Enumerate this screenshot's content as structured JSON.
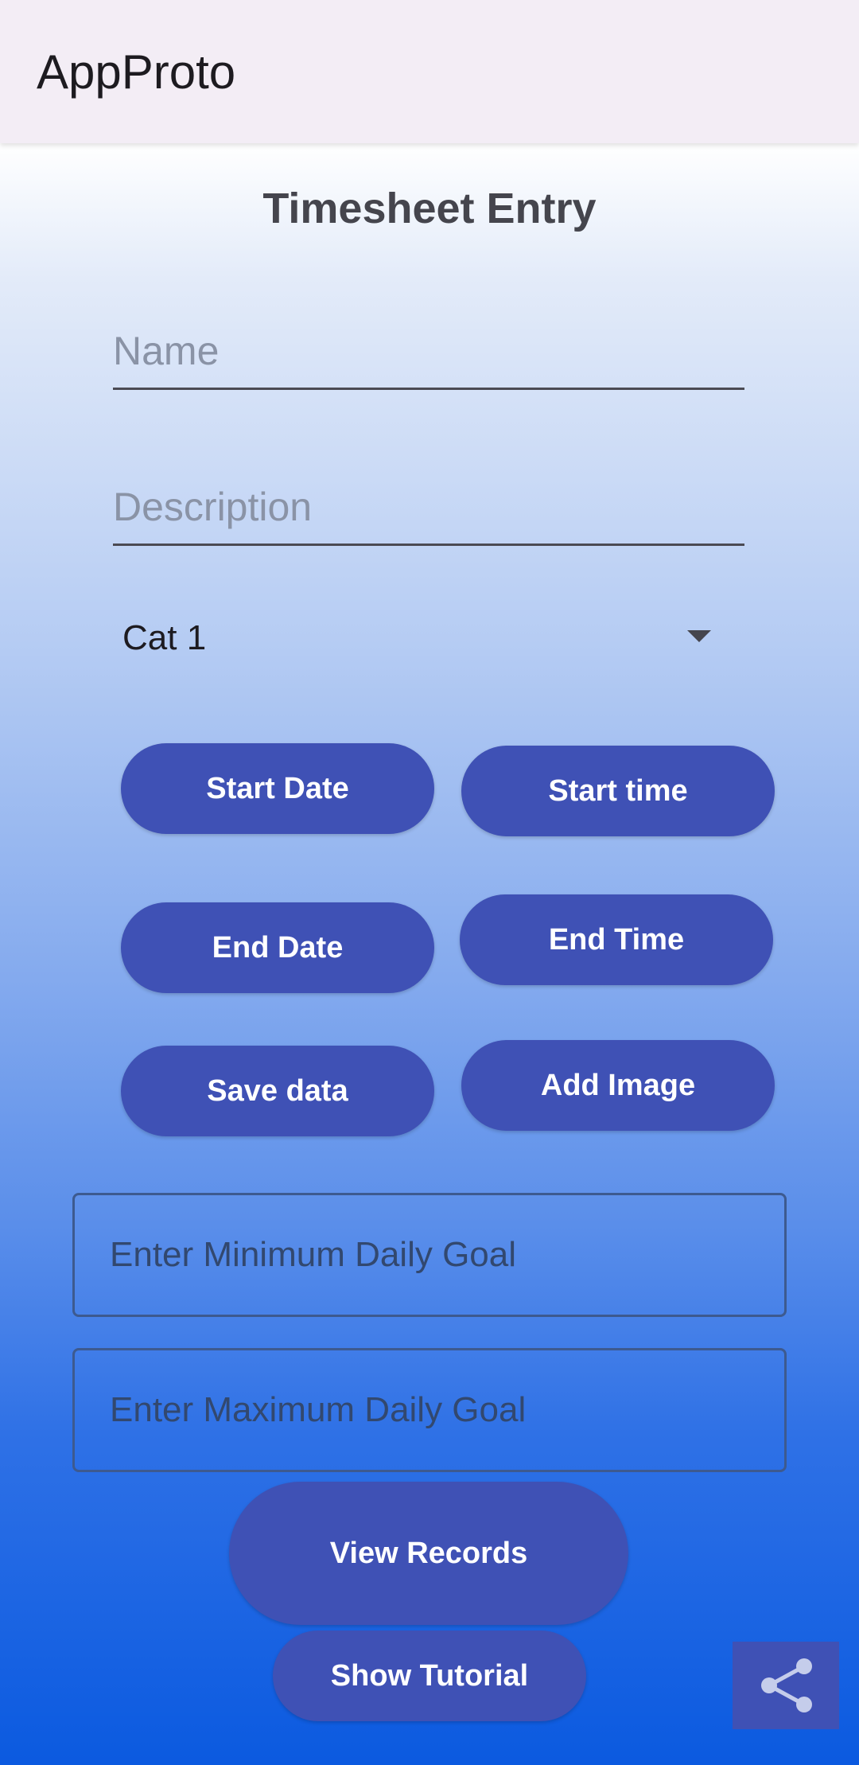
{
  "app_bar": {
    "title": "AppProto",
    "background": "#f3edf5"
  },
  "page": {
    "title": "Timesheet Entry"
  },
  "form": {
    "name_placeholder": "Name",
    "name_value": "",
    "description_placeholder": "Description",
    "description_value": "",
    "category": {
      "selected": "Cat 1",
      "icon": "dropdown-arrow-icon"
    },
    "min_goal_placeholder": "Enter Minimum Daily Goal",
    "min_goal_value": "",
    "max_goal_placeholder": "Enter Maximum Daily Goal",
    "max_goal_value": ""
  },
  "buttons": {
    "start_date": "Start Date",
    "start_time": "Start time",
    "end_date": "End Date",
    "end_time": "End Time",
    "save_data": "Save data",
    "add_image": "Add Image",
    "view_records": "View Records",
    "show_tutorial": "Show Tutorial",
    "share_icon": "share-icon"
  },
  "colors": {
    "button": "#3f51b5",
    "button_text": "#ffffff",
    "gradient_top": "#ffffff",
    "gradient_bottom": "#0b5ae0"
  }
}
